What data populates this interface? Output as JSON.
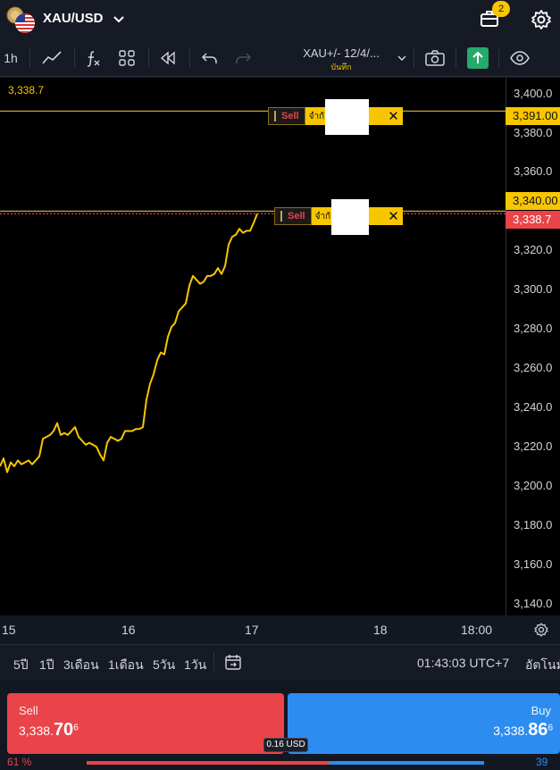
{
  "header": {
    "symbol": "XAU/USD",
    "notification_count": "2"
  },
  "toolbar": {
    "timeframe": "1h",
    "study_title": "XAU+/- 12/4/...",
    "study_subtitle": "บันทึก"
  },
  "chart": {
    "last_price_label": "3,338.7",
    "price_scale": [
      "3,400.0",
      "3,380.0",
      "3,360.0",
      "3,320.0",
      "3,300.0",
      "3,280.0",
      "3,260.0",
      "3,240.0",
      "3,220.0",
      "3,200.0",
      "3,180.0",
      "3,160.0",
      "3,140.0"
    ],
    "time_labels": [
      "15",
      "16",
      "17",
      "18",
      "18:00"
    ],
    "orders": [
      {
        "side": "Sell",
        "take_label": "จำกั",
        "price_tag": "3,391.00",
        "close": "✕"
      },
      {
        "side": "Sell",
        "take_label": "จำกั",
        "price_tag": "3,340.00",
        "close": "✕"
      }
    ],
    "current_price_tag": "3,338.7"
  },
  "chart_data": {
    "type": "line",
    "title": "",
    "xlabel": "",
    "ylabel": "",
    "ylim": [
      3134,
      3408
    ],
    "x": [
      0,
      4,
      8,
      12,
      16,
      20,
      24,
      28,
      32,
      36,
      40,
      44,
      48,
      52,
      56,
      60,
      64,
      68,
      72,
      76,
      80,
      84,
      88,
      92,
      96,
      100,
      104,
      108,
      112,
      116,
      120,
      124,
      128,
      132,
      136,
      140,
      144,
      148,
      152,
      156,
      160,
      164,
      168,
      172,
      176,
      180,
      184,
      188,
      192,
      196,
      200,
      204,
      208,
      212,
      216,
      220,
      224,
      228,
      232,
      236,
      240,
      244,
      248,
      252,
      256,
      260,
      264,
      268,
      272,
      276,
      280,
      284,
      288
    ],
    "series": [
      {
        "values": [
          3210,
          3214,
          3207,
          3212,
          3210,
          3213,
          3211,
          3212,
          3213,
          3211,
          3213,
          3215,
          3224,
          3225,
          3226,
          3228,
          3232,
          3226,
          3227,
          3226,
          3228,
          3230,
          3225,
          3223,
          3221,
          3222,
          3221,
          3220,
          3216,
          3213,
          3222,
          3225,
          3224,
          3223,
          3224,
          3228,
          3228,
          3228,
          3229,
          3229,
          3230,
          3244,
          3252,
          3257,
          3264,
          3268,
          3267,
          3276,
          3281,
          3283,
          3289,
          3291,
          3293,
          3302,
          3307,
          3305,
          3303,
          3304,
          3307,
          3307,
          3308,
          3311,
          3308,
          3312,
          3323,
          3327,
          3328,
          3331,
          3329,
          3330,
          3330,
          3334,
          3338.7
        ]
      }
    ],
    "grid": false,
    "legend": "none",
    "line_color": "#f7c600"
  },
  "ranges": [
    "5ปี",
    "1ปี",
    "3เดือน",
    "1เดือน",
    "5วัน",
    "1วัน"
  ],
  "footer": {
    "clock": "01:43:03 UTC+7",
    "adjust": "อัตโนมั"
  },
  "trade": {
    "sell_label": "Sell",
    "sell_price_prefix": "3,338.",
    "sell_price_big": "70",
    "sell_price_sup": "6",
    "buy_label": "Buy",
    "buy_price_prefix": "3,338.",
    "buy_price_big": "86",
    "buy_price_sup": "6",
    "spread": "0.16 USD",
    "sell_pct": "61 %",
    "buy_pct": "39 %",
    "sell_fraction": 0.61
  }
}
